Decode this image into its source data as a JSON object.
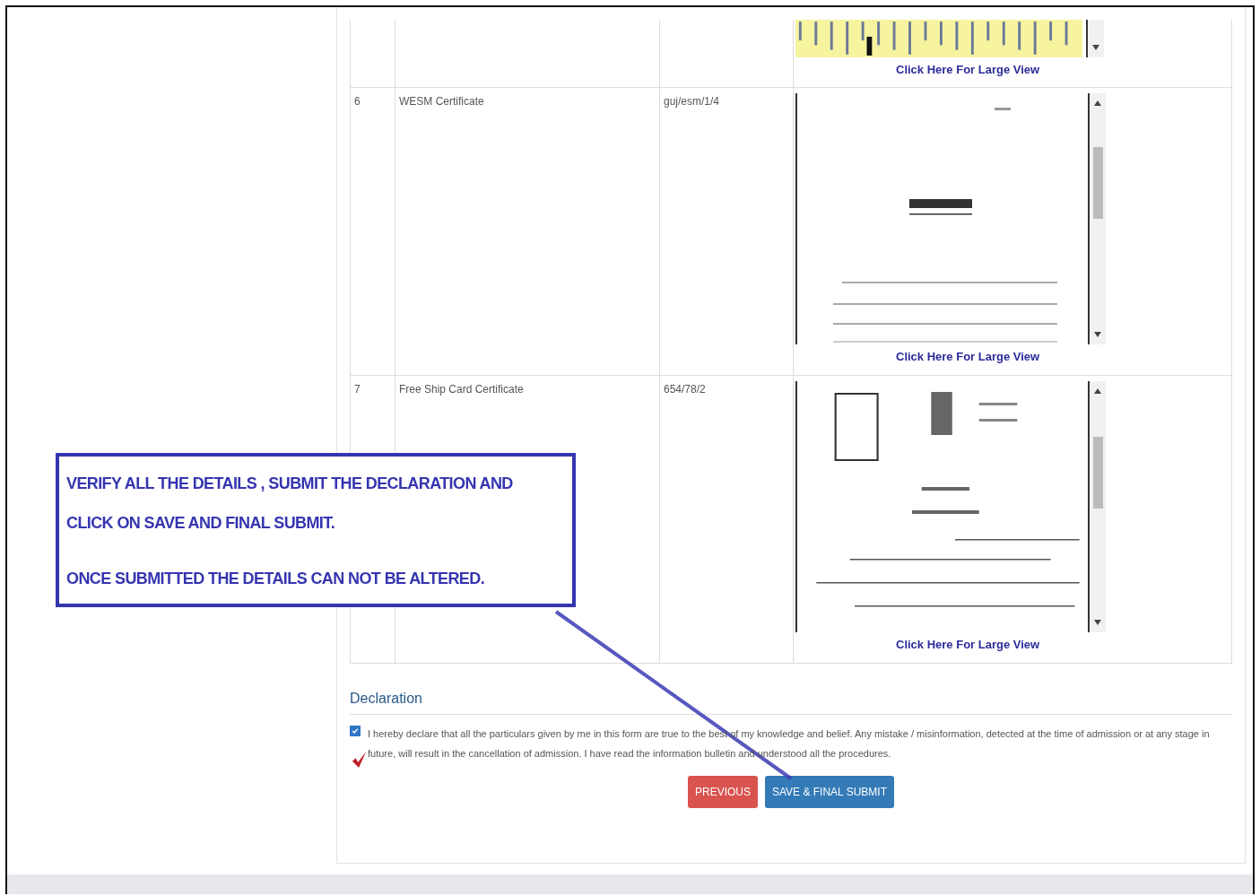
{
  "documents": [
    {
      "kind": "partial",
      "link": "Click Here For Large View"
    },
    {
      "kind": "full",
      "sno": "6",
      "name": "WESM Certificate",
      "number": "guj/esm/1/4",
      "link": "Click Here For Large View"
    },
    {
      "kind": "full",
      "sno": "7",
      "name": "Free Ship Card Certificate",
      "number": "654/78/2",
      "link": "Click Here For Large View"
    }
  ],
  "declaration": {
    "title": "Declaration",
    "checked": true,
    "text": "I hereby declare that all the particulars given by me in this form are true to the best of my knowledge and belief. Any mistake / misinformation, detected at the time of admission or at any stage in future, will result in the cancellation of admission. I have read the information bulletin and understood all the procedures."
  },
  "buttons": [
    {
      "kind": "danger",
      "label": "PREVIOUS"
    },
    {
      "kind": "primary",
      "label": "SAVE & FINAL SUBMIT"
    }
  ],
  "callout": {
    "lines": [
      "VERIFY ALL THE DETAILS ,  SUBMIT THE DECLARATION AND",
      "CLICK ON SAVE AND FINAL SUBMIT.",
      "ONCE SUBMITTED THE DETAILS CAN NOT BE ALTERED."
    ]
  }
}
